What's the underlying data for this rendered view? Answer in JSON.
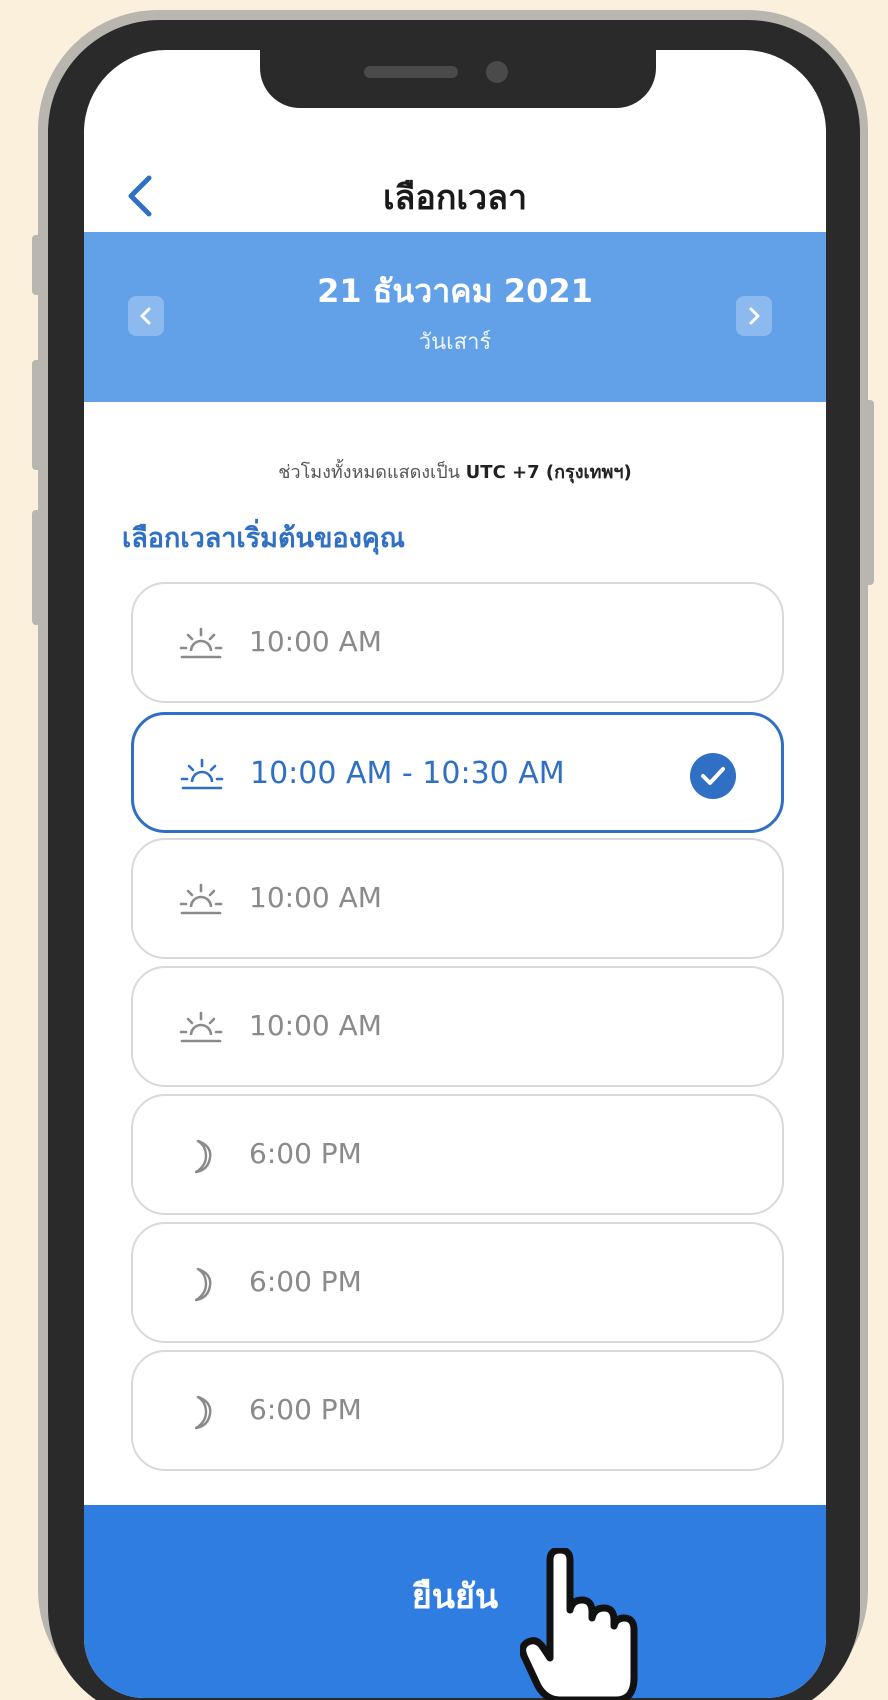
{
  "header": {
    "title": "เลือกเวลา",
    "back_icon": "chevron-left-icon"
  },
  "date_picker": {
    "date": "21 ธันวาคม 2021",
    "weekday": "วันเสาร์",
    "prev_icon": "chevron-left-icon",
    "next_icon": "chevron-right-icon",
    "band_color": "#62a0e8"
  },
  "timezone_note": {
    "prefix": "ช่วโมงทั้งหมดแสดงเป็น",
    "zone": "UTC +7 (กรุงเทพฯ)"
  },
  "section_title": "เลือกเวลาเริ่มต้นของคุณ",
  "slots": [
    {
      "label": "10:00 AM",
      "icon": "sunrise-icon",
      "selected": false
    },
    {
      "label": "10:00 AM - 10:30 AM",
      "icon": "sunrise-icon",
      "selected": true
    },
    {
      "label": "10:00 AM",
      "icon": "sunrise-icon",
      "selected": false
    },
    {
      "label": "10:00 AM",
      "icon": "sunrise-icon",
      "selected": false
    },
    {
      "label": "6:00 PM",
      "icon": "moon-icon",
      "selected": false
    },
    {
      "label": "6:00 PM",
      "icon": "moon-icon",
      "selected": false
    },
    {
      "label": "6:00 PM",
      "icon": "moon-icon",
      "selected": false
    }
  ],
  "confirm": {
    "label": "ยืนยัน",
    "color": "#2f7de0"
  },
  "accent_color": "#2f6fc4"
}
